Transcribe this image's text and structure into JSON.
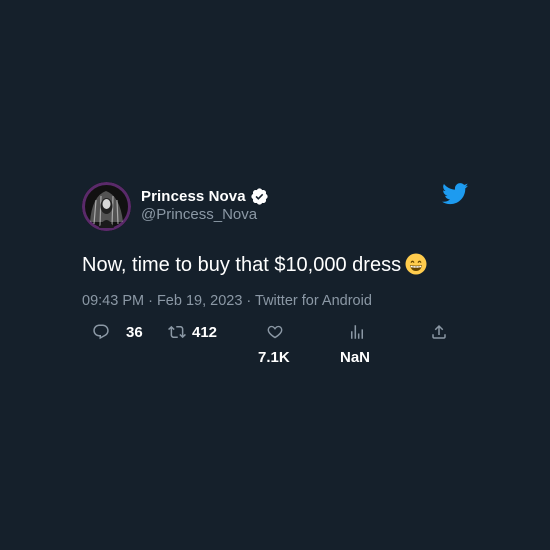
{
  "tweet": {
    "display_name": "Princess Nova",
    "handle": "@Princess_Nova",
    "text": "Now, time to buy that $10,000 dress",
    "emoji": "grinning-face-with-smiling-eyes",
    "timestamp": "09:43 PM · Feb 19, 2023 · Twitter for Android",
    "replies": "36",
    "retweets": "412",
    "likes": "7.1K",
    "views": "NaN"
  },
  "icons": {
    "verified": "verified-badge-icon",
    "brand": "twitter-bird-icon",
    "reply": "reply-icon",
    "retweet": "retweet-icon",
    "like": "heart-icon",
    "views": "views-icon",
    "share": "share-icon"
  },
  "colors": {
    "background": "#15202b",
    "accent": "#1d9bf0",
    "secondary_text": "#8b98a5",
    "primary_text": "#ffffff"
  }
}
